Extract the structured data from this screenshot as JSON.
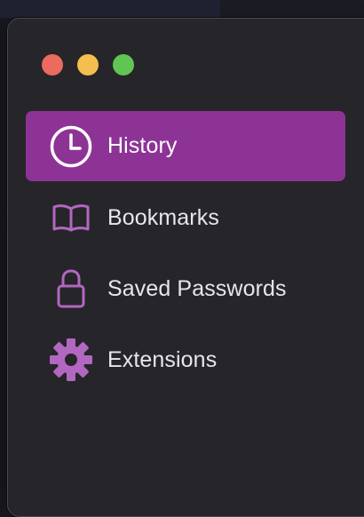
{
  "window": {
    "controls": [
      "close",
      "minimize",
      "maximize"
    ]
  },
  "sidebar": {
    "selected_index": 0,
    "items": [
      {
        "label": "History",
        "icon": "clock-icon"
      },
      {
        "label": "Bookmarks",
        "icon": "book-icon"
      },
      {
        "label": "Saved Passwords",
        "icon": "lock-icon"
      },
      {
        "label": "Extensions",
        "icon": "gear-icon"
      }
    ]
  },
  "colors": {
    "accent": "#8e3396",
    "icon": "#b267c0",
    "window_bg": "#262529",
    "close": "#ec6a5e",
    "minimize": "#f4bf4f",
    "maximize": "#61c554"
  }
}
